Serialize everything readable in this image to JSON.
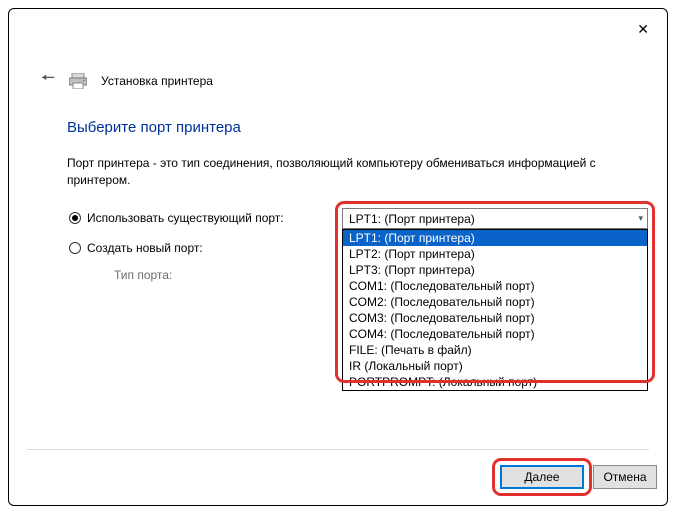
{
  "window": {
    "title": "Установка принтера"
  },
  "section": {
    "heading": "Выберите порт принтера",
    "description": "Порт принтера - это тип соединения, позволяющий компьютеру обмениваться информацией с принтером."
  },
  "options": {
    "use_existing": "Использовать существующий порт:",
    "create_new": "Создать новый порт:",
    "port_type_label": "Тип порта:"
  },
  "combo": {
    "selected": "LPT1: (Порт принтера)",
    "items": [
      "LPT1: (Порт принтера)",
      "LPT2: (Порт принтера)",
      "LPT3: (Порт принтера)",
      "COM1: (Последовательный порт)",
      "COM2: (Последовательный порт)",
      "COM3: (Последовательный порт)",
      "COM4: (Последовательный порт)",
      "FILE: (Печать в файл)",
      "IR (Локальный порт)",
      "PORTPROMPT: (Локальный порт)"
    ],
    "selected_index": 0
  },
  "buttons": {
    "next": "Далее",
    "cancel": "Отмена"
  }
}
